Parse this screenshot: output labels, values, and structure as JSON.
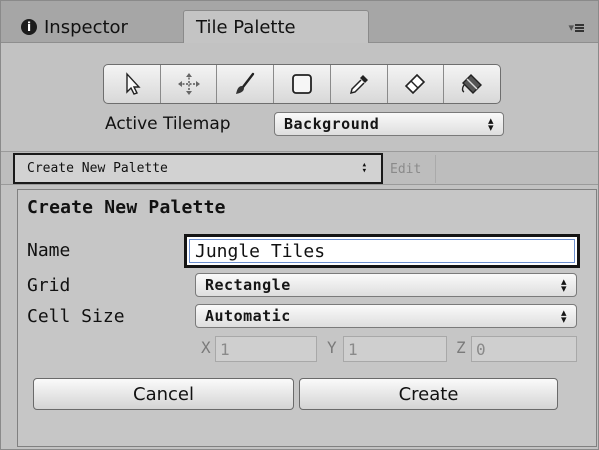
{
  "tabs": [
    {
      "label": "Inspector",
      "icon": "info-icon"
    },
    {
      "label": "Tile Palette"
    }
  ],
  "tab_menu_label": "▾",
  "tools": [
    "select-tool-icon",
    "move-tool-icon",
    "paintbrush-icon",
    "box-fill-icon",
    "eyedropper-icon",
    "eraser-icon",
    "paint-bucket-icon"
  ],
  "active_tilemap": {
    "label": "Active Tilemap",
    "value": "Background"
  },
  "palette_bar": {
    "dropdown_value": "Create New Palette",
    "edit_label": "Edit"
  },
  "create_panel": {
    "title": "Create New Palette",
    "name_label": "Name",
    "name_value": "Jungle Tiles",
    "grid_label": "Grid",
    "grid_value": "Rectangle",
    "cell_size_label": "Cell Size",
    "cell_size_value": "Automatic",
    "x_label": "X",
    "x_value": "1",
    "y_label": "Y",
    "y_value": "1",
    "z_label": "Z",
    "z_value": "0",
    "cancel_label": "Cancel",
    "create_label": "Create"
  }
}
